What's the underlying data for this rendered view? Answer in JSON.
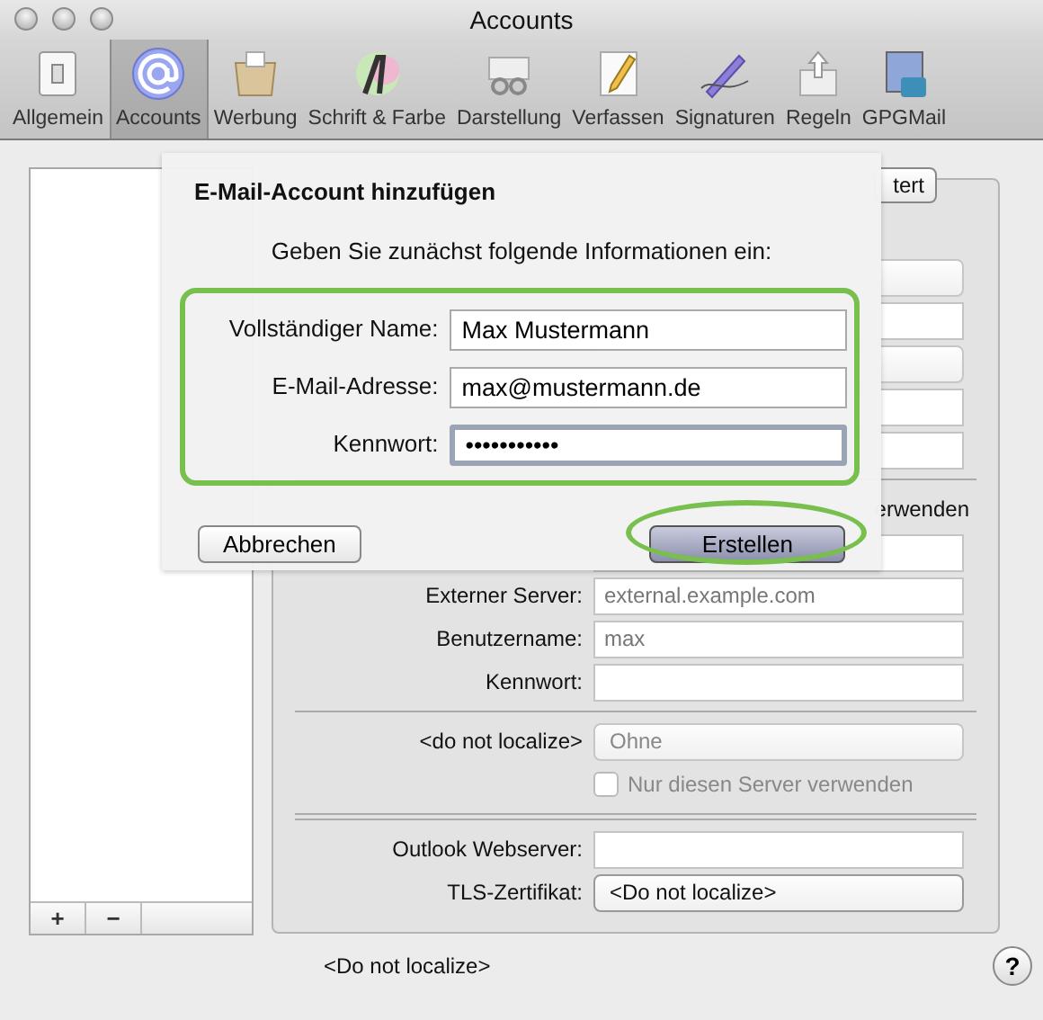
{
  "window": {
    "title": "Accounts"
  },
  "toolbar": [
    {
      "label": "Allgemein",
      "kind": "switch",
      "selected": false
    },
    {
      "label": "Accounts",
      "kind": "at",
      "selected": true
    },
    {
      "label": "Werbung",
      "kind": "bin",
      "selected": false
    },
    {
      "label": "Schrift & Farbe",
      "kind": "font",
      "selected": false
    },
    {
      "label": "Darstellung",
      "kind": "glasses",
      "selected": false
    },
    {
      "label": "Verfassen",
      "kind": "pencil",
      "selected": false
    },
    {
      "label": "Signaturen",
      "kind": "pen",
      "selected": false
    },
    {
      "label": "Regeln",
      "kind": "arrows",
      "selected": false
    },
    {
      "label": "GPGMail",
      "kind": "stamp",
      "selected": false
    }
  ],
  "account_list": {
    "buttons": [
      "+",
      "−"
    ]
  },
  "sheet": {
    "title": "E-Mail-Account hinzufügen",
    "intro": "Geben Sie zunächst folgende Informationen ein:",
    "fields": [
      {
        "label": "Vollständiger Name:",
        "value": "Max Mustermann",
        "focused": false
      },
      {
        "label": "E-Mail-Adresse:",
        "value": "max@mustermann.de",
        "focused": false
      },
      {
        "label": "Kennwort:",
        "value": "•••••••••••",
        "focused": true
      }
    ],
    "buttons": [
      {
        "label": "Abbrechen",
        "default": false
      },
      {
        "label": "Erstellen",
        "default": true
      }
    ]
  },
  "panel": {
    "tab_fragment": "tert",
    "check_fragment": "erwenden",
    "upper_rows": [
      {
        "kind": "select"
      },
      {
        "kind": "field"
      },
      {
        "kind": "select"
      },
      {
        "kind": "field"
      },
      {
        "kind": "field"
      },
      {
        "kind": "rule"
      },
      {
        "kind": "text"
      },
      {
        "kind": "field"
      }
    ],
    "rows": [
      {
        "kind": "field",
        "label": "Externer Server:",
        "value": "external.example.com"
      },
      {
        "kind": "field",
        "label": "Benutzername:",
        "value": "max"
      },
      {
        "kind": "field",
        "label": "Kennwort:"
      },
      {
        "kind": "rule"
      },
      {
        "kind": "select",
        "label": "<do not localize>",
        "value": "Ohne"
      },
      {
        "kind": "checkbox",
        "label": "Nur diesen Server verwenden",
        "checked": false
      },
      {
        "kind": "double_rule"
      },
      {
        "kind": "field",
        "label": "Outlook Webserver:"
      },
      {
        "kind": "select_on",
        "label": "TLS-Zertifikat:",
        "value": "<Do not localize>"
      }
    ]
  },
  "footer": {
    "text": "<Do not localize>",
    "help": "?"
  }
}
